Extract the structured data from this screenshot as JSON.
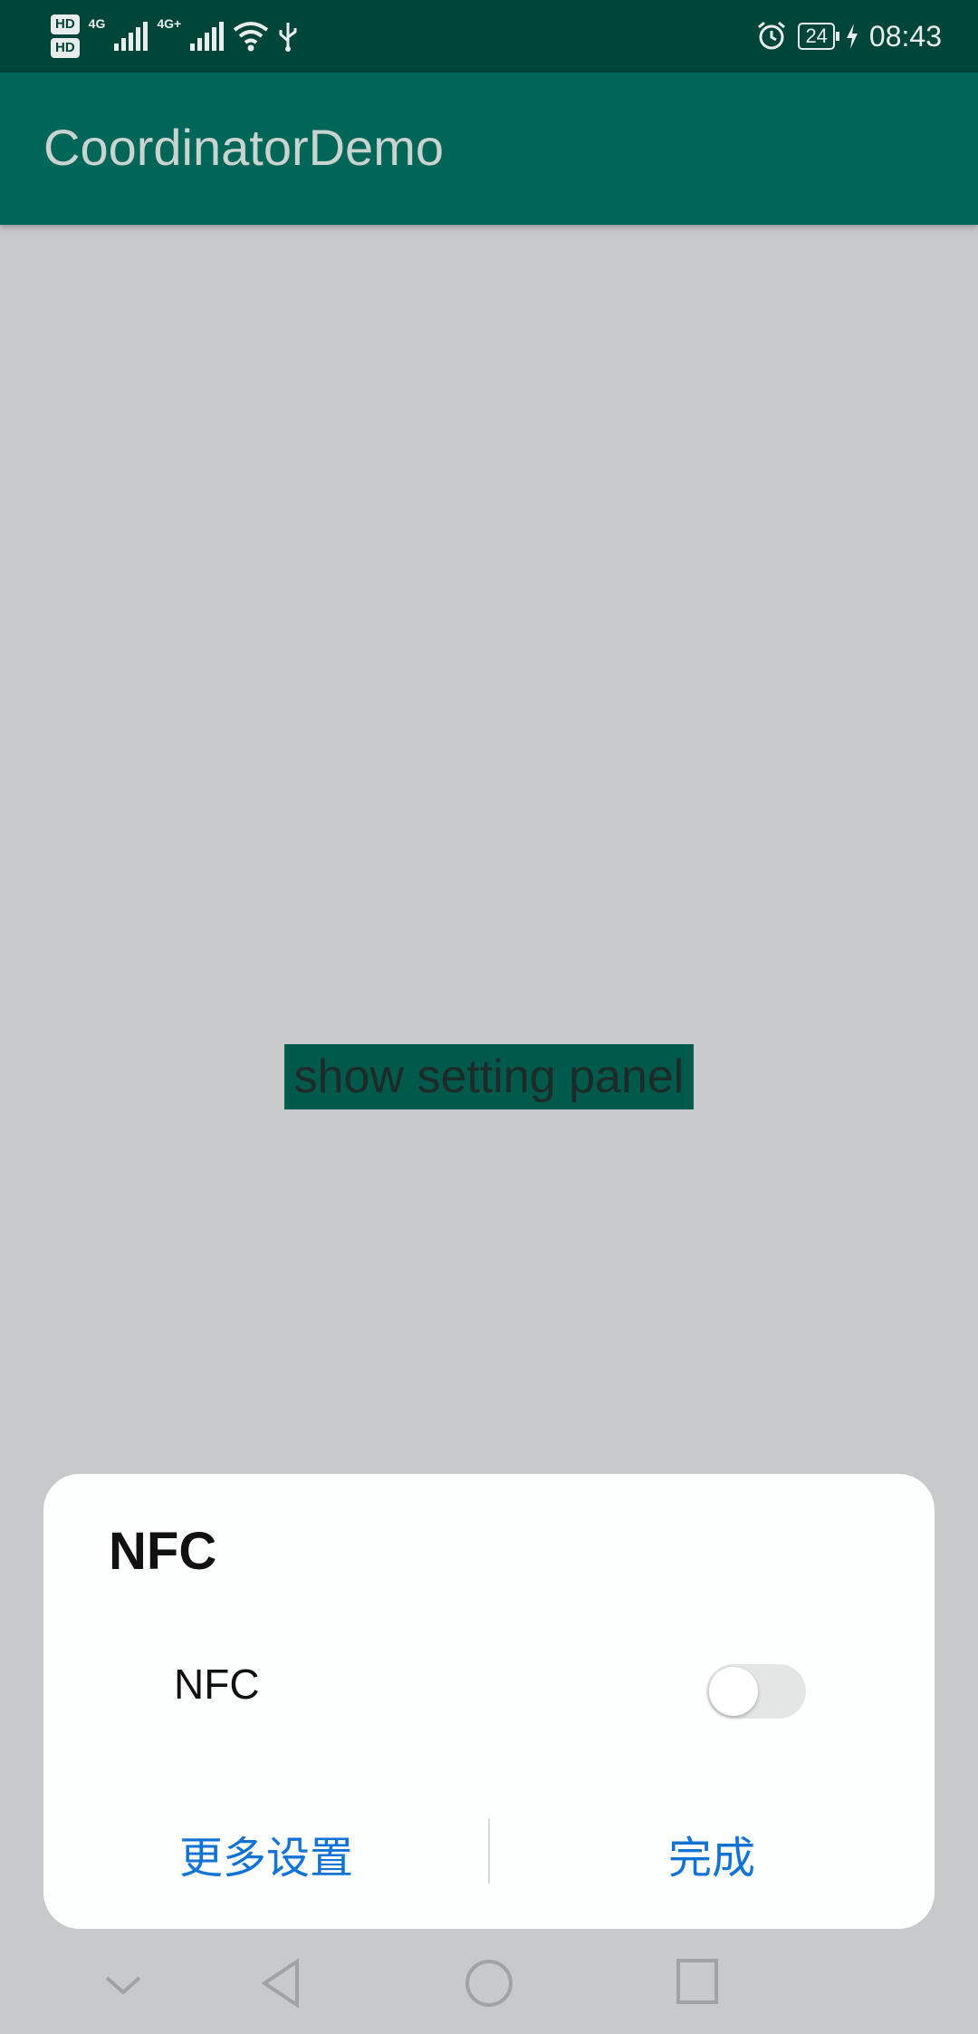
{
  "status_bar": {
    "hd1": "HD",
    "hd2": "HD",
    "net1": "4G",
    "net2": "4G+",
    "battery": "24",
    "time": "08:43"
  },
  "app_bar": {
    "title": "CoordinatorDemo"
  },
  "main": {
    "button_label": "show setting panel"
  },
  "dialog": {
    "title": "NFC",
    "row_label": "NFC",
    "toggle_on": false,
    "more_settings_label": "更多设置",
    "done_label": "完成"
  },
  "colors": {
    "app_bar": "#006657",
    "status_bar": "#00453a",
    "scrim": "#c8c9ca",
    "accent": "#1273d4"
  }
}
